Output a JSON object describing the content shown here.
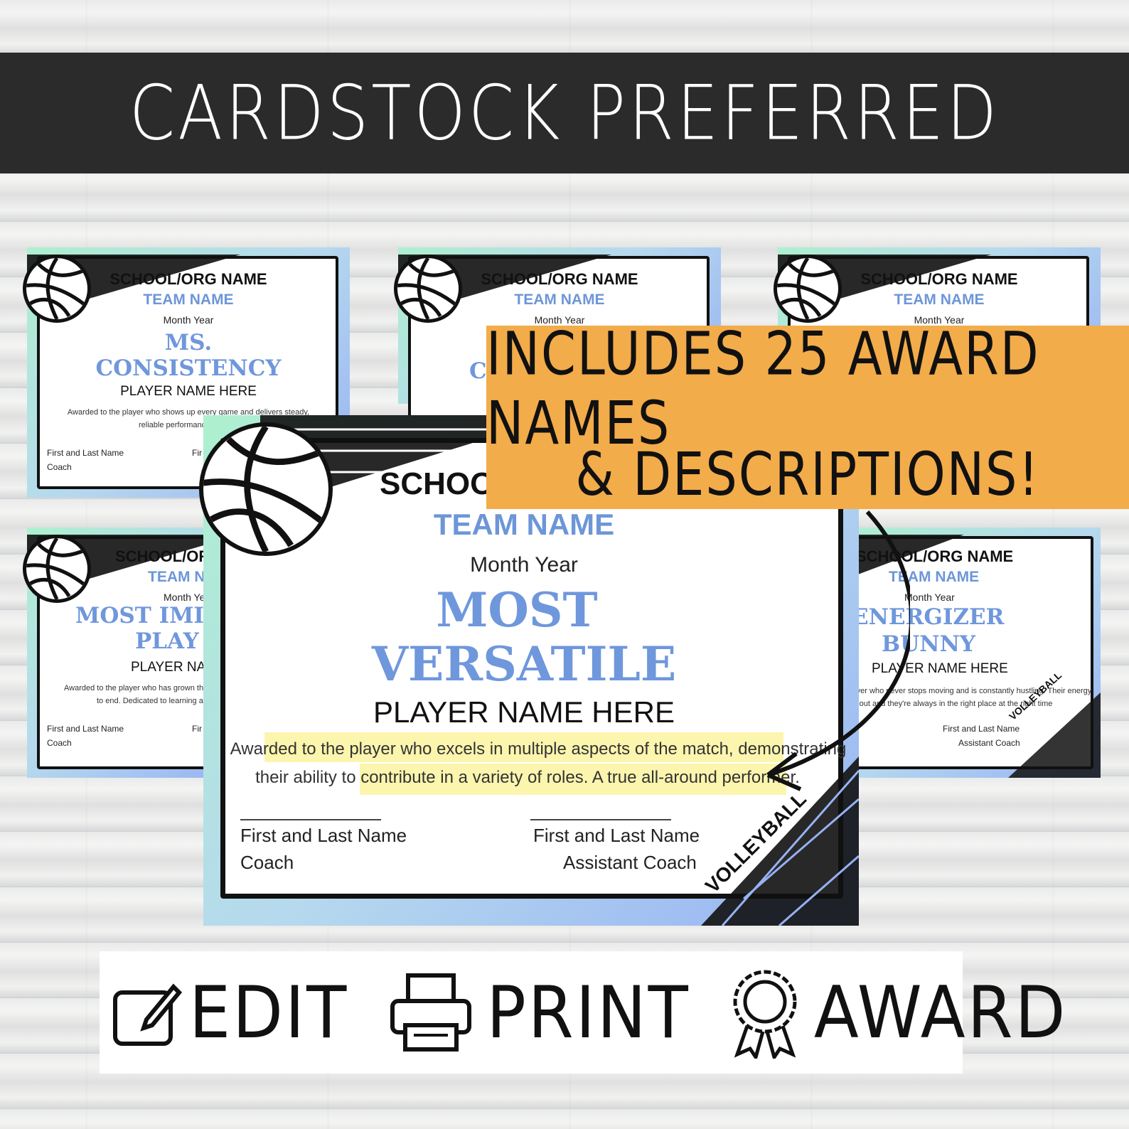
{
  "banner_top": "CARDSTOCK PREFERRED",
  "orange_banner": {
    "line1": "INCLUDES 25 AWARD NAMES",
    "line2": "& DESCRIPTIONS!"
  },
  "bottom_bar": {
    "edit": "EDIT",
    "print": "PRINT",
    "award": "AWARD"
  },
  "cert_small_1": {
    "org": "SCHOOL/ORG NAME",
    "team": "TEAM NAME",
    "month": "Month Year",
    "award1": "MS.",
    "award2": "CONSISTENCY",
    "player": "PLAYER NAME HERE",
    "desc1": "Awarded to the player who shows up every game and delivers steady,",
    "desc2": "reliable performance, no mat",
    "sig1": "First and Last Name",
    "role1": "Coach",
    "sig2": "Fir"
  },
  "cert_small_2": {
    "org": "SCHOOL/ORG NAME",
    "team": "TEAM NAME",
    "month": "Month Year",
    "award_partial": "C"
  },
  "cert_small_3": {
    "org": "SCHOOL/ORG NAME",
    "team": "TEAM NAME",
    "month": "Month Year"
  },
  "cert_small_4": {
    "org": "SCHOOL/ORG",
    "team": "TEAM NA",
    "month": "Month Yea",
    "award1": "MOST IMI",
    "award2": "PLAY",
    "player": "PLAYER NAM",
    "desc1": "Awarded to the player who has grown the",
    "desc2": "to end. Dedicated to learning an",
    "sig1": "First and Last Name",
    "role1": "Coach",
    "sig2": "Fir"
  },
  "cert_small_5": {
    "org": "SCHOOL/ORG NAME",
    "team": "TEAM NAME",
    "month": "Month Year",
    "award1": "ENERGIZER",
    "award2": "BUNNY",
    "player": "PLAYER NAME HERE",
    "desc1": "player who never stops moving and is constantly hustling. Their energy",
    "desc2": "ns out and they're always in the right place at the right time",
    "sig2": "First and Last Name",
    "role2": "Assistant Coach",
    "corner": "VOLLEYBALL"
  },
  "cert_main": {
    "org": "SCHOO",
    "team": "TEAM NAME",
    "month": "Month Year",
    "award1": "MOST",
    "award2": "VERSATILE",
    "player": "PLAYER NAME HERE",
    "desc1": "Awarded to the player who excels in multiple aspects of the match, demonstrating",
    "desc2": "their ability to contribute in a variety of roles. A true all-around performer.",
    "sig1": "First and Last Name",
    "role1": "Coach",
    "sig2": "First and Last Name",
    "role2": "Assistant Coach",
    "corner": "VOLLEYBALL"
  },
  "colors": {
    "banner": "#2b2b2b",
    "orange": "#f3ac4a",
    "accent_blue": "#6f97dc",
    "highlight": "#fbf3a0"
  },
  "icons": [
    "edit-icon",
    "printer-icon",
    "award-ribbon-icon",
    "volleyball-icon"
  ]
}
